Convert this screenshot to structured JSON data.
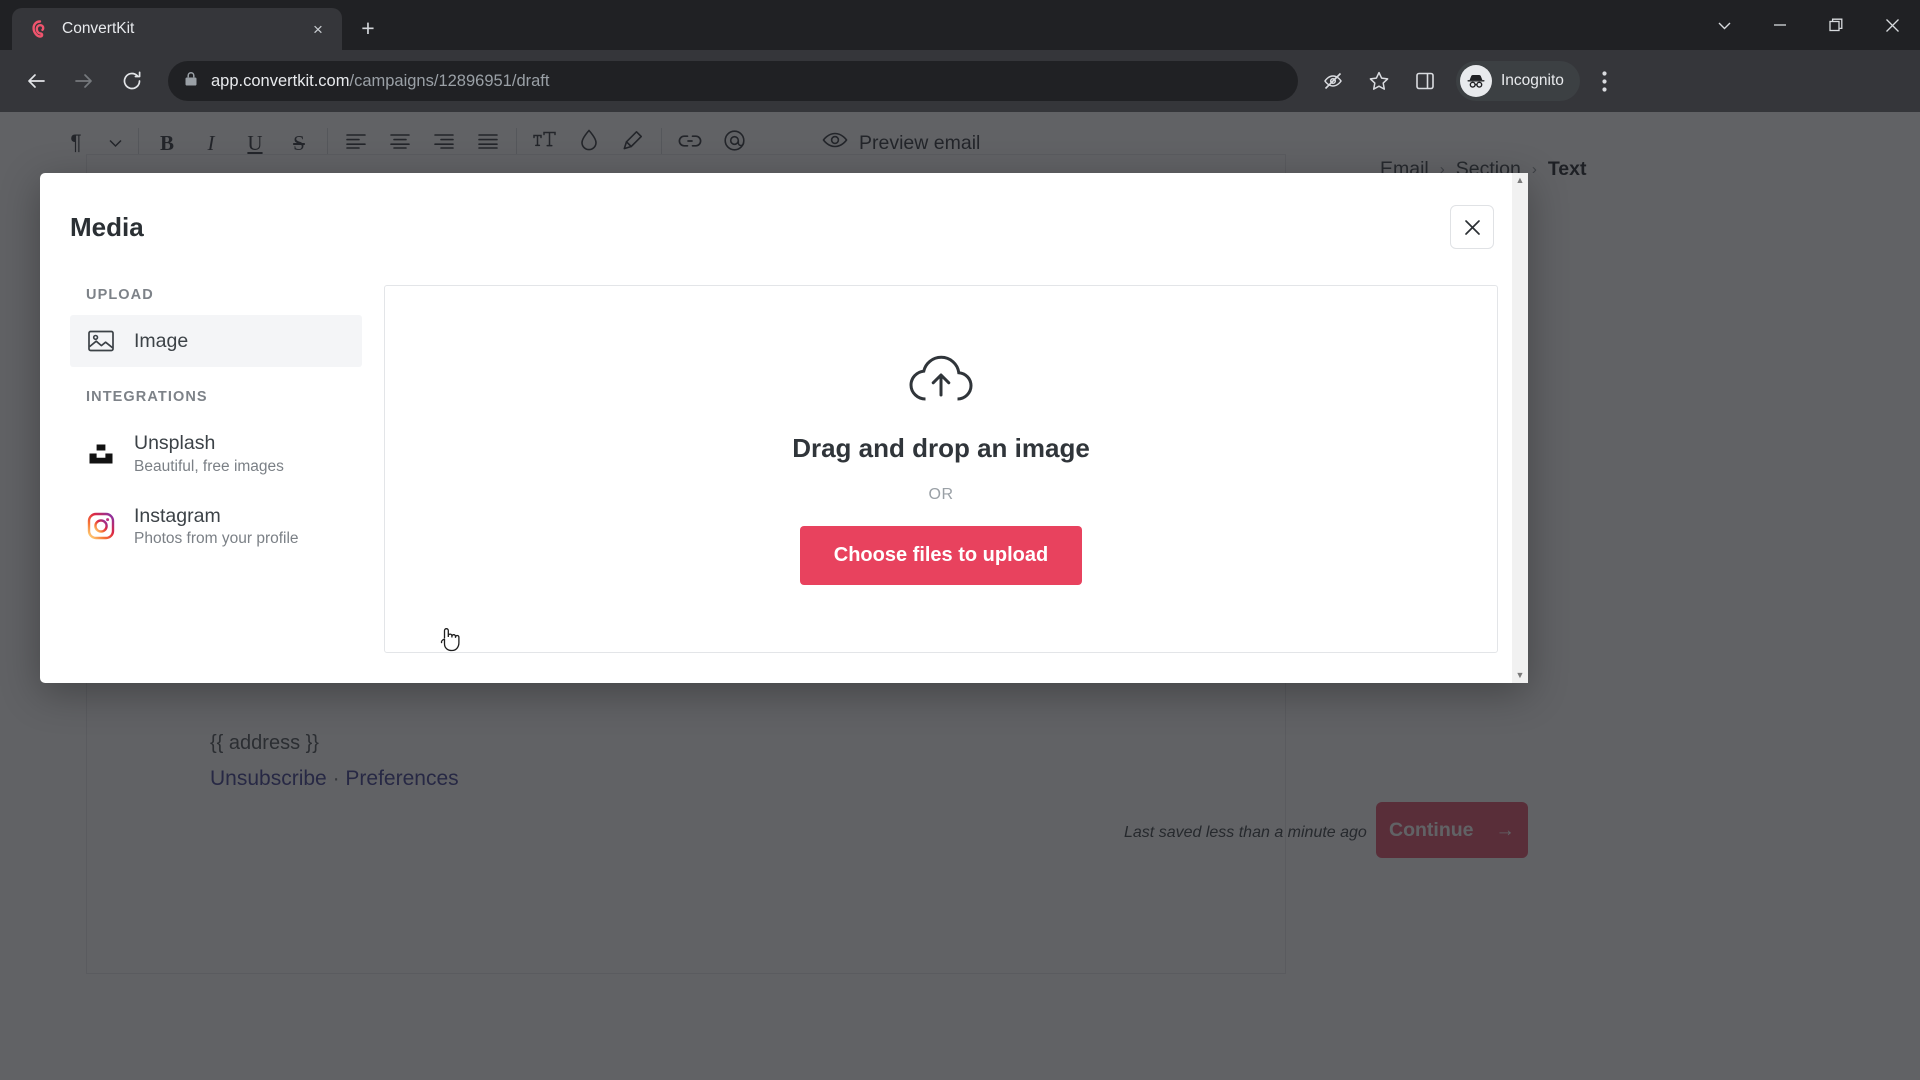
{
  "browser": {
    "tab": {
      "title": "ConvertKit",
      "favicon": "convertkit-logo-icon",
      "close": "×"
    },
    "new_tab": "+",
    "window_controls": {
      "minimize": "—",
      "maximize": "❐",
      "close": "✕",
      "more": "⌄"
    },
    "url": {
      "domain": "app.convertkit.com",
      "path": "/campaigns/12896951/draft",
      "lock": "lock-icon"
    },
    "profile_label": "Incognito"
  },
  "editor": {
    "toolbar": {
      "paragraph": "¶",
      "chevron": "⌄",
      "bold": "B",
      "italic": "I",
      "underline": "U",
      "strikethrough": "S",
      "align_left": "align-left-icon",
      "align_center": "align-center-icon",
      "align_right": "align-right-icon",
      "align_justify": "align-justify-icon",
      "font_size": "font-size-icon",
      "text_color": "text-color-icon",
      "highlight": "highlight-icon",
      "link": "link-icon",
      "mention": "@",
      "preview_label": "Preview email"
    },
    "breadcrumb": {
      "items": [
        "Email",
        "Section",
        "Text"
      ],
      "separator": "›"
    },
    "footer": {
      "address": "{{ address }}",
      "unsubscribe": "Unsubscribe",
      "separator": "·",
      "preferences": "Preferences"
    },
    "save_note": "Last saved less than a minute ago",
    "continue_label": "Continue",
    "continue_arrow": "→"
  },
  "modal": {
    "title": "Media",
    "close": "✕",
    "sections": [
      {
        "heading": "UPLOAD",
        "items": [
          {
            "label": "Image",
            "sub": "",
            "icon": "image-icon",
            "active": true
          }
        ]
      },
      {
        "heading": "INTEGRATIONS",
        "items": [
          {
            "label": "Unsplash",
            "sub": "Beautiful, free images",
            "icon": "unsplash-icon",
            "active": false
          },
          {
            "label": "Instagram",
            "sub": "Photos from your profile",
            "icon": "instagram-icon",
            "active": false
          }
        ]
      }
    ],
    "dropzone": {
      "icon": "cloud-upload-icon",
      "title": "Drag and drop an image",
      "or": "OR",
      "button": "Choose files to upload"
    }
  },
  "colors": {
    "accent_pink": "#e8425e",
    "continue_pink": "#e3536d",
    "chrome_dark": "#202124",
    "chrome_tab": "#35363a",
    "link_blue": "#3c3f8f"
  }
}
